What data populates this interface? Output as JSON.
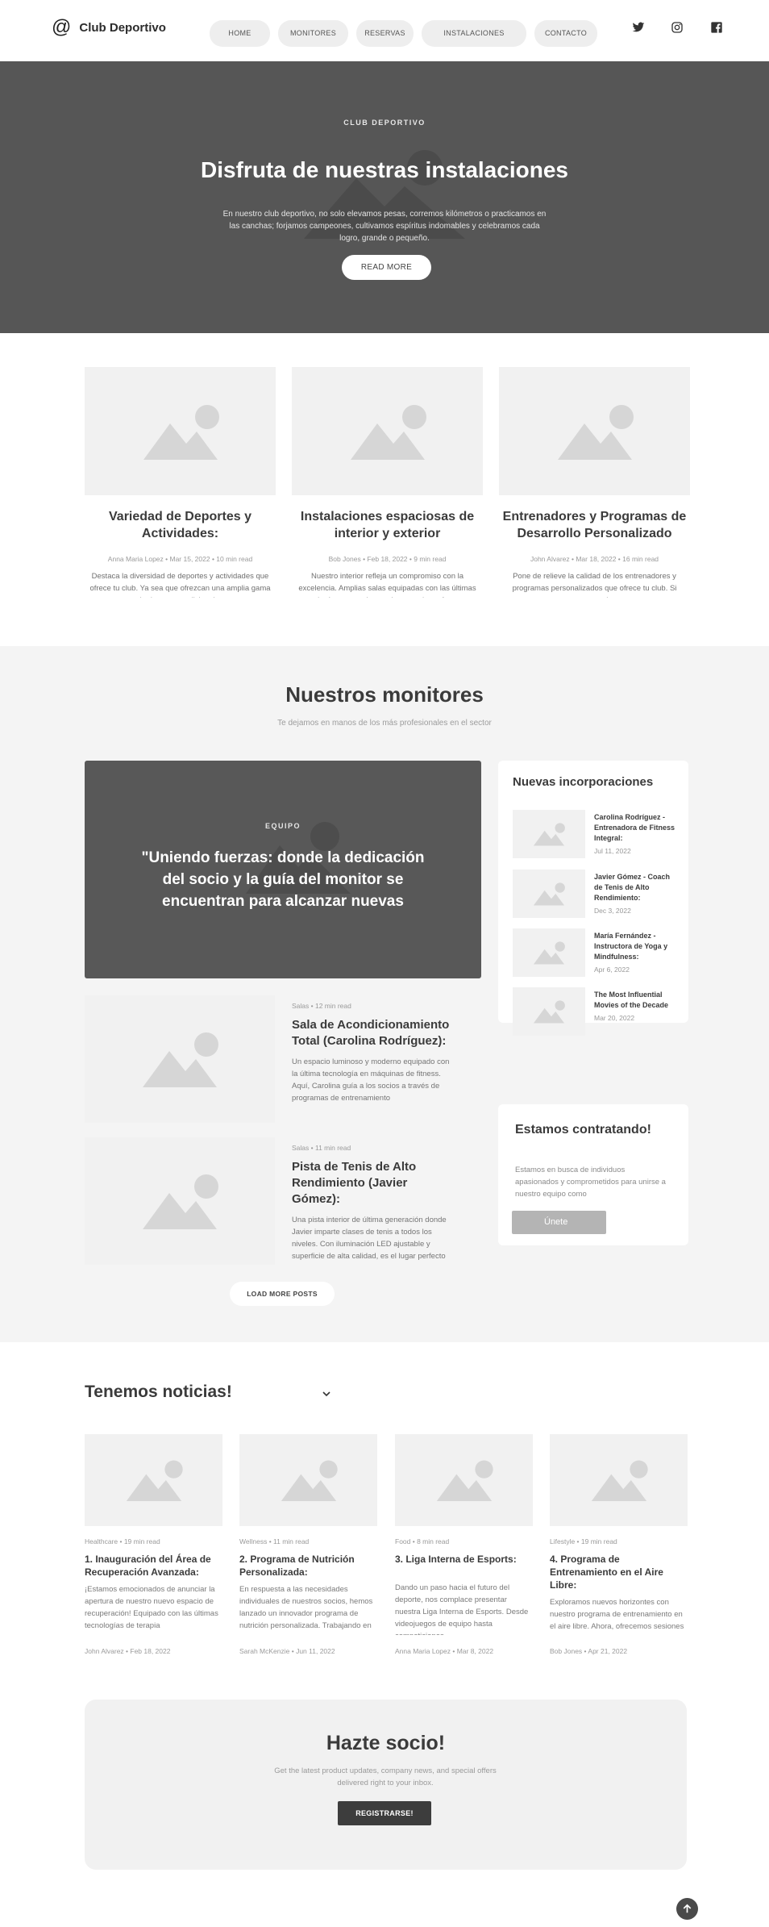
{
  "header": {
    "logo_symbol": "@",
    "brand": "Club Deportivo",
    "nav": [
      {
        "label": "HOME"
      },
      {
        "label": "MONITORES"
      },
      {
        "label": "RESERVAS"
      },
      {
        "label": "INSTALACIONES"
      },
      {
        "label": "CONTACTO"
      }
    ],
    "social": [
      "twitter-icon",
      "instagram-icon",
      "facebook-icon"
    ]
  },
  "hero": {
    "eyebrow": "CLUB DEPORTIVO",
    "title": "Disfruta de nuestras instalaciones",
    "text": "En nuestro club deportivo, no solo elevamos pesas, corremos kilómetros o practicamos en las canchas; forjamos campeones, cultivamos espíritus indomables y celebramos cada logro, grande o pequeño.",
    "button": "READ MORE"
  },
  "features": [
    {
      "title": "Variedad de Deportes y Actividades:",
      "author": "Anna Maria Lopez",
      "date": "Mar 15, 2022",
      "read": "10 min read",
      "text": "Destaca la diversidad de deportes y actividades que ofrece tu club. Ya sea que ofrezcan una amplia gama de deportes tradicionales"
    },
    {
      "title": "Instalaciones espaciosas de interior y exterior",
      "author": "Bob Jones",
      "date": "Feb 18, 2022",
      "read": "9 min read",
      "text": "Nuestro interior refleja un compromiso con la excelencia. Amplias salas equipadas con las últimas tecnologías proporcionan el escenario perfecto para"
    },
    {
      "title": "Entrenadores y Programas de Desarrollo Personalizado",
      "author": "John Alvarez",
      "date": "Mar 18, 2022",
      "read": "16 min read",
      "text": "Pone de relieve la calidad de los entrenadores y programas personalizados que ofrece tu club. Si cuentas con entrenadores expertos"
    }
  ],
  "monitores": {
    "title": "Nuestros monitores",
    "subtitle": "Te dejamos en manos de los más profesionales en el sector",
    "featured": {
      "eyebrow": "EQUIPO",
      "quote": "\"Uniendo fuerzas: donde la dedicación del socio y la guía del monitor se encuentran para alcanzar nuevas metas\""
    },
    "posts": [
      {
        "category": "Salas",
        "read": "12 min read",
        "title": "Sala de Acondicionamiento Total (Carolina Rodríguez):",
        "text": "Un espacio luminoso y moderno equipado con la última tecnología en máquinas de fitness. Aquí, Carolina guía a los socios a través de programas de entrenamiento"
      },
      {
        "category": "Salas",
        "read": "11 min read",
        "title": "Pista de Tenis de Alto Rendimiento (Javier Gómez):",
        "text": "Una pista interior de última generación donde Javier imparte clases de tenis a todos los niveles. Con iluminación LED ajustable y superficie de alta calidad, es el lugar perfecto"
      }
    ],
    "load_more": "LOAD MORE POSTS"
  },
  "sidebar": {
    "title": "Nuevas incorporaciones",
    "items": [
      {
        "title": "Carolina Rodríguez - Entrenadora de Fitness Integral:",
        "date": "Jul 11, 2022"
      },
      {
        "title": "Javier Gómez - Coach de Tenis de Alto Rendimiento:",
        "date": "Dec 3, 2022"
      },
      {
        "title": "María Fernández - Instructora de Yoga y Mindfulness:",
        "date": "Apr 6, 2022"
      },
      {
        "title": "The Most Influential Movies of the Decade",
        "date": "Mar 20, 2022"
      }
    ]
  },
  "hiring": {
    "title": "Estamos contratando!",
    "text": "Estamos en busca de individuos apasionados y comprometidos para unirse a nuestro equipo como",
    "button": "Únete"
  },
  "news": {
    "title": "Tenemos noticias!",
    "items": [
      {
        "category": "Healthcare",
        "read": "19 min read",
        "title": "1. Inauguración del Área de Recuperación Avanzada:",
        "text": "¡Estamos emocionados de anunciar la apertura de nuestro nuevo espacio de recuperación! Equipado con las últimas tecnologías de terapia",
        "author": "John Alvarez",
        "date": "Feb 18, 2022"
      },
      {
        "category": "Wellness",
        "read": "11 min read",
        "title": "2. Programa de Nutrición Personalizada:",
        "text": "En respuesta a las necesidades individuales de nuestros socios, hemos lanzado un innovador programa de nutrición personalizada. Trabajando en",
        "author": "Sarah McKenzie",
        "date": "Jun 11, 2022"
      },
      {
        "category": "Food",
        "read": "8 min read",
        "title": "3. Liga Interna de Esports:",
        "text": "Dando un paso hacia el futuro del deporte, nos complace presentar nuestra Liga Interna de Esports. Desde videojuegos de equipo hasta competiciones",
        "author": "Anna Maria Lopez",
        "date": "Mar 8, 2022"
      },
      {
        "category": "Lifestyle",
        "read": "19 min read",
        "title": "4. Programa de Entrenamiento en el Aire Libre:",
        "text": "Exploramos nuevos horizontes con nuestro programa de entrenamiento en el aire libre. Ahora, ofrecemos sesiones",
        "author": "Bob Jones",
        "date": "Apr 21, 2022"
      }
    ]
  },
  "cta": {
    "title": "Hazte socio!",
    "text": "Get the latest product updates, company news, and special offers delivered right to your inbox.",
    "button": "REGISTRARSE!"
  },
  "colors": {
    "hero_bg": "#565656",
    "placeholder_bg": "#f1f1f1",
    "placeholder_fg": "#d6d6d6",
    "page_bg": "#f4f4f4"
  }
}
